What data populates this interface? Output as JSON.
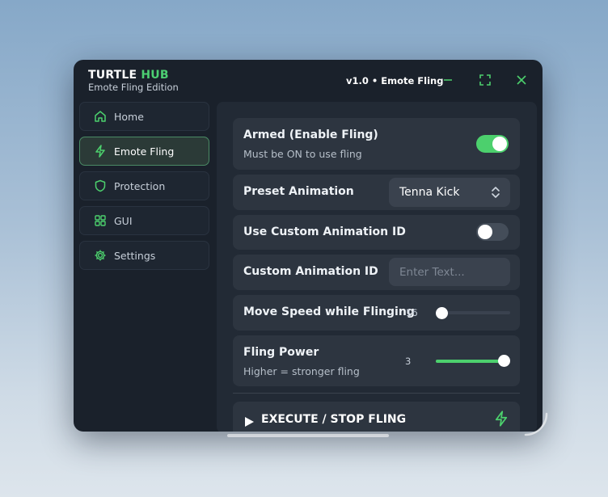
{
  "app": {
    "title_part1": "TURTLE",
    "title_part2": "HUB",
    "subtitle": "Emote Fling Edition",
    "version": "v1.0 • Emote Fling"
  },
  "colors": {
    "accent": "#4cd06d",
    "window_bg": "#1a212b",
    "panel_bg": "#222a35",
    "row_bg": "#2d3540"
  },
  "window_controls": [
    {
      "name": "minimize",
      "icon": "minus-icon"
    },
    {
      "name": "maximize",
      "icon": "maximize-icon"
    },
    {
      "name": "close",
      "icon": "close-icon"
    }
  ],
  "sidebar": {
    "items": [
      {
        "label": "Home",
        "icon": "home-icon",
        "active": false
      },
      {
        "label": "Emote Fling",
        "icon": "lightning-icon",
        "active": true
      },
      {
        "label": "Protection",
        "icon": "shield-icon",
        "active": false
      },
      {
        "label": "GUI",
        "icon": "grid-icon",
        "active": false
      },
      {
        "label": "Settings",
        "icon": "gear-icon",
        "active": false
      }
    ]
  },
  "main": {
    "armed": {
      "label": "Armed (Enable Fling)",
      "description": "Must be ON to use fling",
      "on": true
    },
    "preset": {
      "label": "Preset Animation",
      "value": "Tenna Kick"
    },
    "use_custom": {
      "label": "Use Custom Animation ID",
      "on": false
    },
    "custom_id": {
      "label": "Custom Animation ID",
      "value": "",
      "placeholder": "Enter Text..."
    },
    "move_speed": {
      "label": "Move Speed while Flinging",
      "value": "16",
      "fraction": 0.0
    },
    "fling_power": {
      "label": "Fling Power",
      "description": "Higher = stronger fling",
      "value": "3",
      "fraction": 1.0
    },
    "execute": {
      "label": "EXECUTE / STOP FLING",
      "icon": "lightning-icon"
    }
  }
}
